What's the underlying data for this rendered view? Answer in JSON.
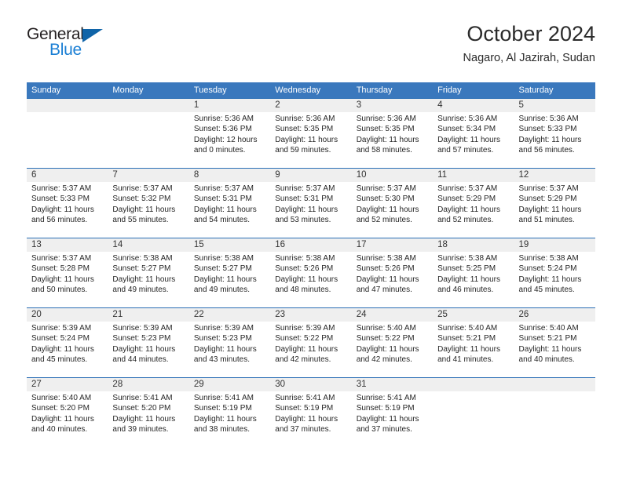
{
  "brand": {
    "name_top": "General",
    "name_bottom": "Blue",
    "accent_dark": "#1064a8",
    "accent_light": "#1b7fd4"
  },
  "header": {
    "title": "October 2024",
    "subtitle": "Nagaro, Al Jazirah, Sudan"
  },
  "theme": {
    "header_blue": "#3a78bd",
    "rule_blue": "#2a6eb5",
    "daynum_band": "#efefef"
  },
  "weekdays": [
    "Sunday",
    "Monday",
    "Tuesday",
    "Wednesday",
    "Thursday",
    "Friday",
    "Saturday"
  ],
  "weeks": [
    [
      {
        "day": ""
      },
      {
        "day": ""
      },
      {
        "day": "1",
        "sunrise": "Sunrise: 5:36 AM",
        "sunset": "Sunset: 5:36 PM",
        "daylight1": "Daylight: 12 hours",
        "daylight2": "and 0 minutes."
      },
      {
        "day": "2",
        "sunrise": "Sunrise: 5:36 AM",
        "sunset": "Sunset: 5:35 PM",
        "daylight1": "Daylight: 11 hours",
        "daylight2": "and 59 minutes."
      },
      {
        "day": "3",
        "sunrise": "Sunrise: 5:36 AM",
        "sunset": "Sunset: 5:35 PM",
        "daylight1": "Daylight: 11 hours",
        "daylight2": "and 58 minutes."
      },
      {
        "day": "4",
        "sunrise": "Sunrise: 5:36 AM",
        "sunset": "Sunset: 5:34 PM",
        "daylight1": "Daylight: 11 hours",
        "daylight2": "and 57 minutes."
      },
      {
        "day": "5",
        "sunrise": "Sunrise: 5:36 AM",
        "sunset": "Sunset: 5:33 PM",
        "daylight1": "Daylight: 11 hours",
        "daylight2": "and 56 minutes."
      }
    ],
    [
      {
        "day": "6",
        "sunrise": "Sunrise: 5:37 AM",
        "sunset": "Sunset: 5:33 PM",
        "daylight1": "Daylight: 11 hours",
        "daylight2": "and 56 minutes."
      },
      {
        "day": "7",
        "sunrise": "Sunrise: 5:37 AM",
        "sunset": "Sunset: 5:32 PM",
        "daylight1": "Daylight: 11 hours",
        "daylight2": "and 55 minutes."
      },
      {
        "day": "8",
        "sunrise": "Sunrise: 5:37 AM",
        "sunset": "Sunset: 5:31 PM",
        "daylight1": "Daylight: 11 hours",
        "daylight2": "and 54 minutes."
      },
      {
        "day": "9",
        "sunrise": "Sunrise: 5:37 AM",
        "sunset": "Sunset: 5:31 PM",
        "daylight1": "Daylight: 11 hours",
        "daylight2": "and 53 minutes."
      },
      {
        "day": "10",
        "sunrise": "Sunrise: 5:37 AM",
        "sunset": "Sunset: 5:30 PM",
        "daylight1": "Daylight: 11 hours",
        "daylight2": "and 52 minutes."
      },
      {
        "day": "11",
        "sunrise": "Sunrise: 5:37 AM",
        "sunset": "Sunset: 5:29 PM",
        "daylight1": "Daylight: 11 hours",
        "daylight2": "and 52 minutes."
      },
      {
        "day": "12",
        "sunrise": "Sunrise: 5:37 AM",
        "sunset": "Sunset: 5:29 PM",
        "daylight1": "Daylight: 11 hours",
        "daylight2": "and 51 minutes."
      }
    ],
    [
      {
        "day": "13",
        "sunrise": "Sunrise: 5:37 AM",
        "sunset": "Sunset: 5:28 PM",
        "daylight1": "Daylight: 11 hours",
        "daylight2": "and 50 minutes."
      },
      {
        "day": "14",
        "sunrise": "Sunrise: 5:38 AM",
        "sunset": "Sunset: 5:27 PM",
        "daylight1": "Daylight: 11 hours",
        "daylight2": "and 49 minutes."
      },
      {
        "day": "15",
        "sunrise": "Sunrise: 5:38 AM",
        "sunset": "Sunset: 5:27 PM",
        "daylight1": "Daylight: 11 hours",
        "daylight2": "and 49 minutes."
      },
      {
        "day": "16",
        "sunrise": "Sunrise: 5:38 AM",
        "sunset": "Sunset: 5:26 PM",
        "daylight1": "Daylight: 11 hours",
        "daylight2": "and 48 minutes."
      },
      {
        "day": "17",
        "sunrise": "Sunrise: 5:38 AM",
        "sunset": "Sunset: 5:26 PM",
        "daylight1": "Daylight: 11 hours",
        "daylight2": "and 47 minutes."
      },
      {
        "day": "18",
        "sunrise": "Sunrise: 5:38 AM",
        "sunset": "Sunset: 5:25 PM",
        "daylight1": "Daylight: 11 hours",
        "daylight2": "and 46 minutes."
      },
      {
        "day": "19",
        "sunrise": "Sunrise: 5:38 AM",
        "sunset": "Sunset: 5:24 PM",
        "daylight1": "Daylight: 11 hours",
        "daylight2": "and 45 minutes."
      }
    ],
    [
      {
        "day": "20",
        "sunrise": "Sunrise: 5:39 AM",
        "sunset": "Sunset: 5:24 PM",
        "daylight1": "Daylight: 11 hours",
        "daylight2": "and 45 minutes."
      },
      {
        "day": "21",
        "sunrise": "Sunrise: 5:39 AM",
        "sunset": "Sunset: 5:23 PM",
        "daylight1": "Daylight: 11 hours",
        "daylight2": "and 44 minutes."
      },
      {
        "day": "22",
        "sunrise": "Sunrise: 5:39 AM",
        "sunset": "Sunset: 5:23 PM",
        "daylight1": "Daylight: 11 hours",
        "daylight2": "and 43 minutes."
      },
      {
        "day": "23",
        "sunrise": "Sunrise: 5:39 AM",
        "sunset": "Sunset: 5:22 PM",
        "daylight1": "Daylight: 11 hours",
        "daylight2": "and 42 minutes."
      },
      {
        "day": "24",
        "sunrise": "Sunrise: 5:40 AM",
        "sunset": "Sunset: 5:22 PM",
        "daylight1": "Daylight: 11 hours",
        "daylight2": "and 42 minutes."
      },
      {
        "day": "25",
        "sunrise": "Sunrise: 5:40 AM",
        "sunset": "Sunset: 5:21 PM",
        "daylight1": "Daylight: 11 hours",
        "daylight2": "and 41 minutes."
      },
      {
        "day": "26",
        "sunrise": "Sunrise: 5:40 AM",
        "sunset": "Sunset: 5:21 PM",
        "daylight1": "Daylight: 11 hours",
        "daylight2": "and 40 minutes."
      }
    ],
    [
      {
        "day": "27",
        "sunrise": "Sunrise: 5:40 AM",
        "sunset": "Sunset: 5:20 PM",
        "daylight1": "Daylight: 11 hours",
        "daylight2": "and 40 minutes."
      },
      {
        "day": "28",
        "sunrise": "Sunrise: 5:41 AM",
        "sunset": "Sunset: 5:20 PM",
        "daylight1": "Daylight: 11 hours",
        "daylight2": "and 39 minutes."
      },
      {
        "day": "29",
        "sunrise": "Sunrise: 5:41 AM",
        "sunset": "Sunset: 5:19 PM",
        "daylight1": "Daylight: 11 hours",
        "daylight2": "and 38 minutes."
      },
      {
        "day": "30",
        "sunrise": "Sunrise: 5:41 AM",
        "sunset": "Sunset: 5:19 PM",
        "daylight1": "Daylight: 11 hours",
        "daylight2": "and 37 minutes."
      },
      {
        "day": "31",
        "sunrise": "Sunrise: 5:41 AM",
        "sunset": "Sunset: 5:19 PM",
        "daylight1": "Daylight: 11 hours",
        "daylight2": "and 37 minutes."
      },
      {
        "day": ""
      },
      {
        "day": ""
      }
    ]
  ]
}
